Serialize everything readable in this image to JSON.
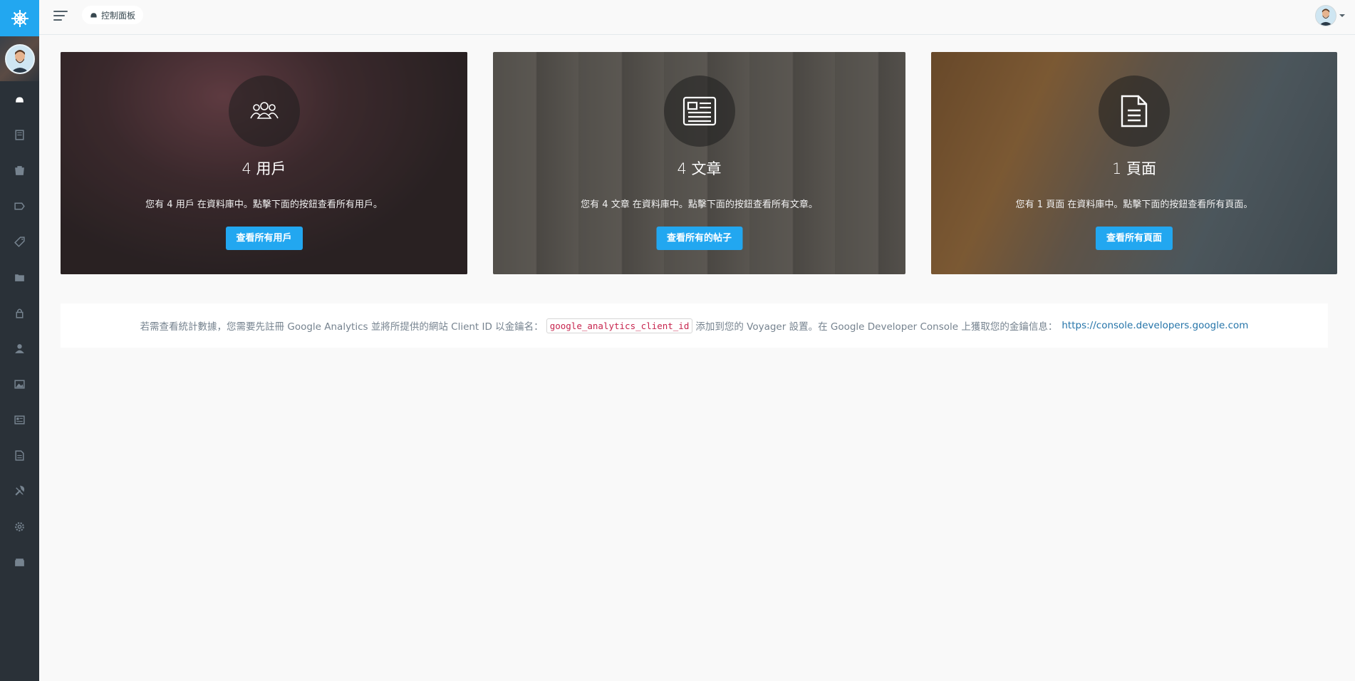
{
  "breadcrumb": {
    "label": "控制面板",
    "icon": "dashboard-icon"
  },
  "sidebar": {
    "items": [
      {
        "icon": "dashboard-icon",
        "active": true
      },
      {
        "icon": "media-icon"
      },
      {
        "icon": "posts-icon"
      },
      {
        "icon": "tag-icon"
      },
      {
        "icon": "tags-icon"
      },
      {
        "icon": "folder-icon"
      },
      {
        "icon": "lock-icon"
      },
      {
        "icon": "user-icon"
      },
      {
        "icon": "image-icon"
      },
      {
        "icon": "news-icon"
      },
      {
        "icon": "document-icon"
      },
      {
        "icon": "tools-icon"
      },
      {
        "icon": "settings-icon"
      },
      {
        "icon": "archive-icon"
      }
    ]
  },
  "panels": [
    {
      "title": "4 用戶",
      "text": "您有 4 用戶 在資料庫中。點擊下面的按鈕查看所有用戶。",
      "button": "查看所有用戶",
      "icon": "users-icon"
    },
    {
      "title": "4 文章",
      "text": "您有 4 文章 在資料庫中。點擊下面的按鈕查看所有文章。",
      "button": "查看所有的帖子",
      "icon": "news-icon"
    },
    {
      "title": "1 頁面",
      "text": "您有 1 頁面 在資料庫中。點擊下面的按鈕查看所有頁面。",
      "button": "查看所有頁面",
      "icon": "document-icon"
    }
  ],
  "analytics": {
    "text_before": "若需查看統計數據，您需要先註冊 Google Analytics 並將所提供的網站 Client ID 以金鑰名：",
    "key": "google_analytics_client_id",
    "text_after": "添加到您的 Voyager 設置。在 Google Developer Console 上獲取您的金鑰信息：",
    "link": "https://console.developers.google.com"
  },
  "colors": {
    "sidebar": "#2a3138",
    "accent": "#22a7f0",
    "link": "#2574a9",
    "code": "#c7254e"
  }
}
